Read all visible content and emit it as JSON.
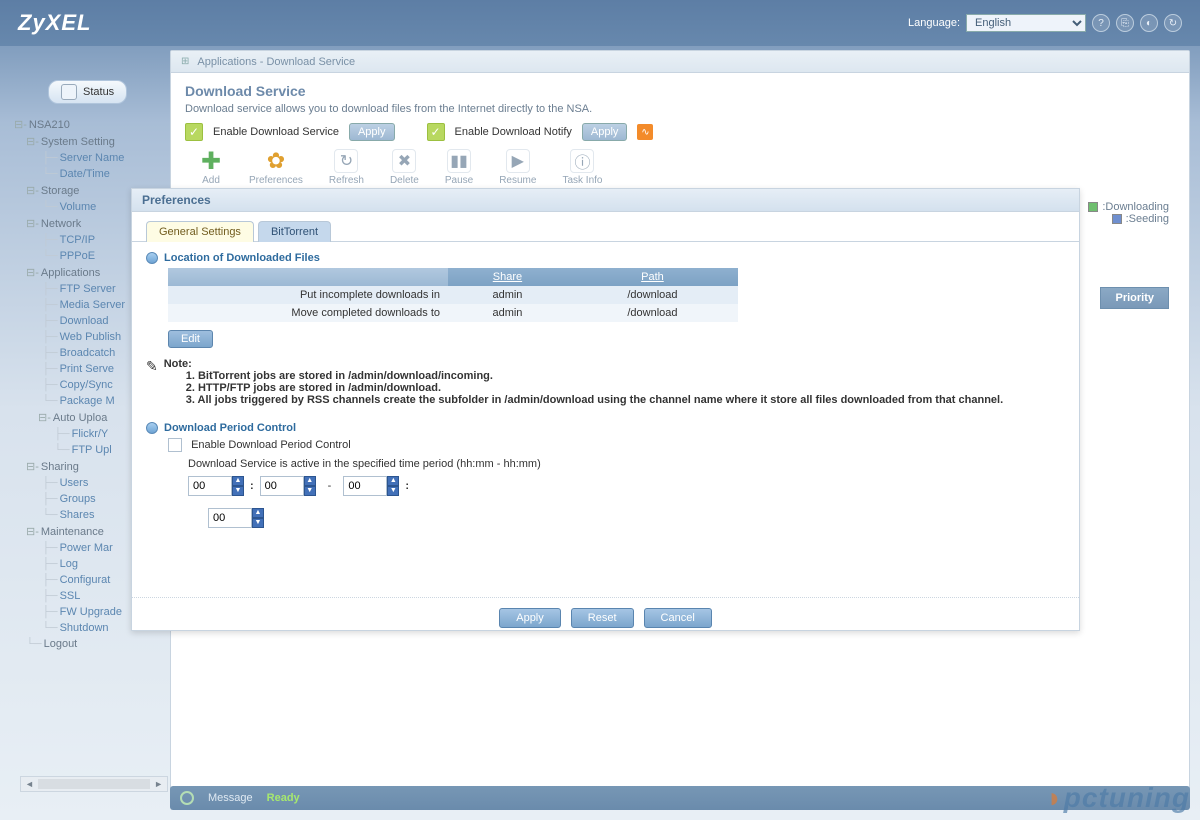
{
  "header": {
    "brand": "ZyXEL",
    "language_label": "Language:",
    "language_value": "English"
  },
  "sidebar": {
    "status_label": "Status",
    "root": "NSA210",
    "groups": [
      {
        "label": "System Setting",
        "items": [
          "Server Name",
          "Date/Time"
        ]
      },
      {
        "label": "Storage",
        "items": [
          "Volume"
        ]
      },
      {
        "label": "Network",
        "items": [
          "TCP/IP",
          "PPPoE"
        ]
      },
      {
        "label": "Applications",
        "items": [
          "FTP Server",
          "Media Server",
          "Download",
          "Web Publish",
          "Broadcatch",
          "Print Serve",
          "Copy/Sync",
          "Package M"
        ]
      },
      {
        "label": "Auto Uploa",
        "indent": true,
        "items": [
          "Flickr/Y",
          "FTP Upl"
        ]
      },
      {
        "label": "Sharing",
        "items": [
          "Users",
          "Groups",
          "Shares"
        ]
      },
      {
        "label": "Maintenance",
        "items": [
          "Power Mar",
          "Log",
          "Configurat",
          "SSL",
          "FW Upgrade",
          "Shutdown"
        ]
      },
      {
        "label": "Logout",
        "items": []
      }
    ]
  },
  "breadcrumb": "Applications - Download Service",
  "page": {
    "title": "Download Service",
    "intro": "Download service allows you to download files from the Internet directly to the NSA.",
    "enable_dl": "Enable Download Service",
    "enable_notify": "Enable Download Notify",
    "apply": "Apply",
    "toolbar": [
      "Add",
      "Preferences",
      "Refresh",
      "Delete",
      "Pause",
      "Resume",
      "Task Info"
    ],
    "legend_dl": ":Downloading",
    "legend_sd": ":Seeding",
    "col_priority": "Priority"
  },
  "modal": {
    "title": "Preferences",
    "tabs": {
      "active": "General Settings",
      "other": "BitTorrent"
    },
    "section1": "Location of Downloaded Files",
    "table": {
      "headers": [
        "",
        "Share",
        "Path"
      ],
      "rows": [
        [
          "Put incomplete downloads in",
          "admin",
          "/download"
        ],
        [
          "Move completed downloads to",
          "admin",
          "/download"
        ]
      ]
    },
    "edit": "Edit",
    "note_head": "Note:",
    "notes": [
      "1. BitTorrent jobs are stored in /admin/download/incoming.",
      "2. HTTP/FTP jobs are stored in /admin/download.",
      "3. All jobs triggered by RSS channels create the subfolder in /admin/download using the channel name where it store all files downloaded from that channel."
    ],
    "section2": "Download Period Control",
    "enable_period": "Enable Download Period Control",
    "period_desc": "Download Service is active in the specified time period (hh:mm - hh:mm)",
    "time": [
      "00",
      "00",
      "00",
      "00"
    ],
    "apply": "Apply",
    "reset": "Reset",
    "cancel": "Cancel"
  },
  "statusbar": {
    "msg": "Message",
    "ready": "Ready"
  },
  "watermark": "pctuning"
}
